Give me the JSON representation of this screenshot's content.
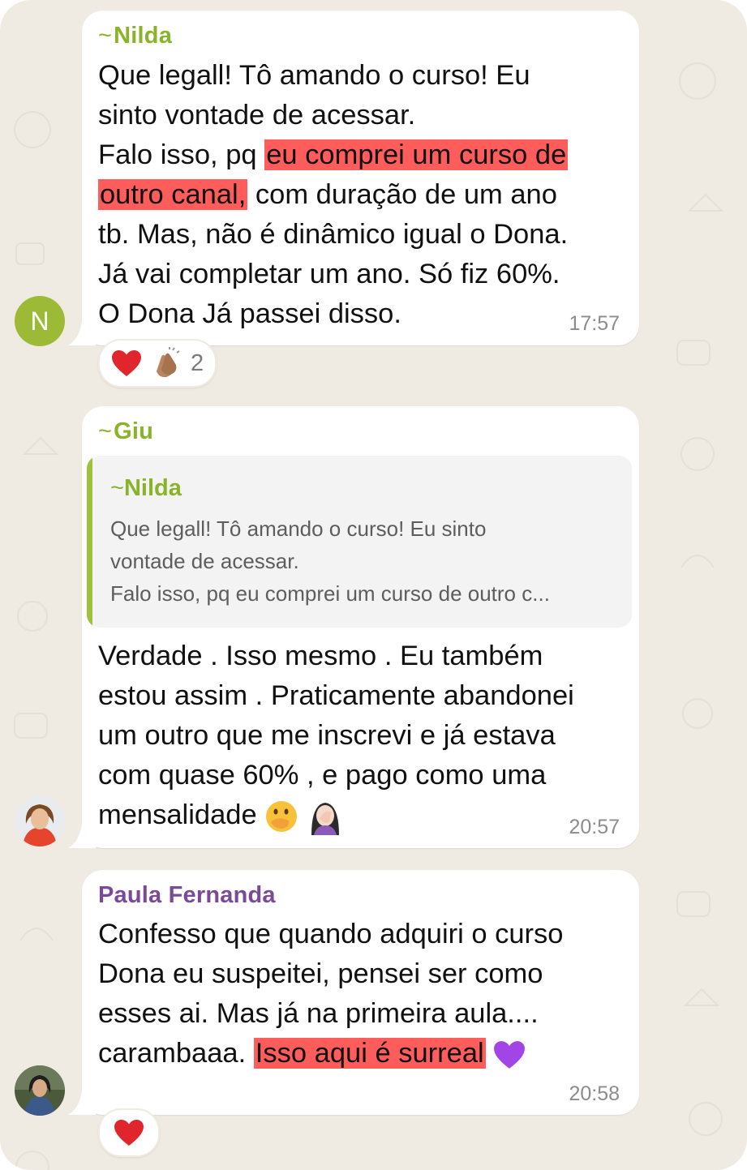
{
  "colors": {
    "background": "#efeae2",
    "bubble": "#ffffff",
    "highlight": "#ff5c5c",
    "nilda_name": "#89b328",
    "giu_name": "#89b328",
    "paula_name": "#7a4a9a",
    "avatar_n": "#9dba36",
    "time": "#8c8c8c"
  },
  "messages": [
    {
      "sender": "Nilda",
      "sender_prefix": "~",
      "lines": [
        "Que legall! Tô amando o curso! Eu",
        "sinto vontade de acessar."
      ],
      "line3_pre": "Falo isso, pq ",
      "line3_highlight": "eu comprei um curso de",
      "line4_highlight": "outro canal,",
      "line4_post": " com duração de um ano",
      "lines_after": [
        "tb. Mas, não é dinâmico igual o Dona.",
        "Já vai completar um ano. Só fiz 60%.",
        "O Dona Já passei disso."
      ],
      "time": "17:57",
      "avatar_letter": "N",
      "reactions": {
        "icons": [
          "red-heart",
          "clapping-hands"
        ],
        "count": "2"
      }
    },
    {
      "sender": "Giu",
      "sender_prefix": "~",
      "quote": {
        "sender_prefix": "~",
        "sender": "Nilda",
        "lines": [
          "Que legall! Tô amando o curso! Eu sinto",
          "vontade de acessar.",
          "Falo isso, pq eu comprei um curso de outro c..."
        ]
      },
      "lines": [
        "Verdade . Isso mesmo . Eu também",
        "estou assim . Praticamente abandonei",
        "um outro que me inscrevi e já estava",
        "com quase 60% , e pago como uma"
      ],
      "last_line": "mensalidade ",
      "emojis": [
        "hand-over-mouth-face",
        "woman-facepalming"
      ],
      "time": "20:57"
    },
    {
      "sender": "Paula Fernanda",
      "lines": [
        "Confesso que quando adquiri o curso",
        "Dona eu suspeitei, pensei ser como",
        "esses ai. Mas já na primeira aula...."
      ],
      "line4_pre": "carambaaa. ",
      "line4_highlight": "Isso aqui é surreal",
      "emoji": "purple-heart",
      "time": "20:58",
      "reactions": {
        "icons": [
          "red-heart"
        ]
      }
    }
  ]
}
